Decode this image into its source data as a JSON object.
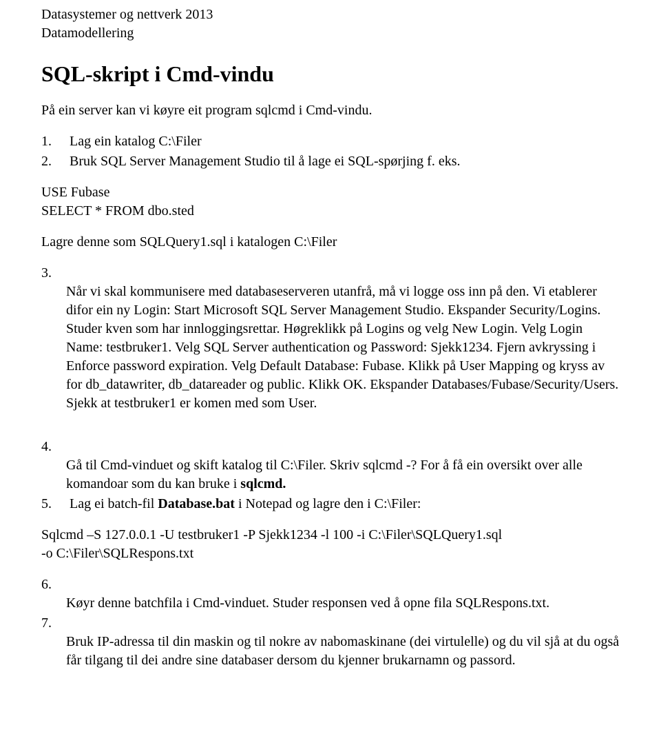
{
  "header": {
    "line1": "Datasystemer og nettverk 2013",
    "line2": "Datamodellering"
  },
  "title": "SQL-skript i Cmd-vindu",
  "intro": "På ein server kan vi køyre eit program sqlcmd  i Cmd-vindu.",
  "steps1": {
    "s1": "Lag ein katalog C:\\Filer",
    "s2": "Bruk  SQL Server Management Studio til å lage ei SQL-spørjing f. eks."
  },
  "sql_block": "USE Fubase\nSELECT * FROM dbo.sted",
  "save_line": "Lagre denne som SQLQuery1.sql  i katalogen C:\\Filer",
  "step3": {
    "text": "Når vi skal kommunisere med databaseserveren utanfrå, må vi logge oss inn på den. Vi etablerer difor ein ny Login: Start Microsoft SQL Server Management Studio. Ekspander Security/Logins. Studer kven som har innloggingsrettar. Høgreklikk på Logins og velg New Login. Velg Login Name: testbruker1. Velg SQL Server authentication og Password: Sjekk1234. Fjern avkryssing i Enforce password expiration. Velg Default Database: Fubase. Klikk på User Mapping og kryss av for db_datawriter, db_datareader og public. Klikk OK. Ekspander Databases/Fubase/Security/Users. Sjekk at testbruker1 er komen med som User."
  },
  "step4": {
    "prefix": "Gå til Cmd-vinduet og skift katalog til C:\\Filer.  Skriv  sqlcmd -?  For å få ein oversikt over alle komandoar som du kan bruke i ",
    "bold": "sqlcmd.",
    "suffix": ""
  },
  "step5": {
    "prefix": "Lag ei batch-fil   ",
    "bold": "Database.bat",
    "suffix": "  i Notepad og lagre den i C:\\Filer:"
  },
  "cmd_block": {
    "line1": "Sqlcmd –S 127.0.0.1  -U testbruker1  -P Sjekk1234  -l 100  -i  C:\\Filer\\SQLQuery1.sql",
    "line2": "-o C:\\Filer\\SQLRespons.txt"
  },
  "step6": "Køyr denne batchfila i Cmd-vinduet. Studer responsen ved å opne fila SQLRespons.txt.",
  "step7": "Bruk IP-adressa til din maskin og til nokre av nabomaskinane (dei virtulelle) og du vil sjå at du også får tilgang til dei andre sine databaser dersom du kjenner brukarnamn og passord."
}
